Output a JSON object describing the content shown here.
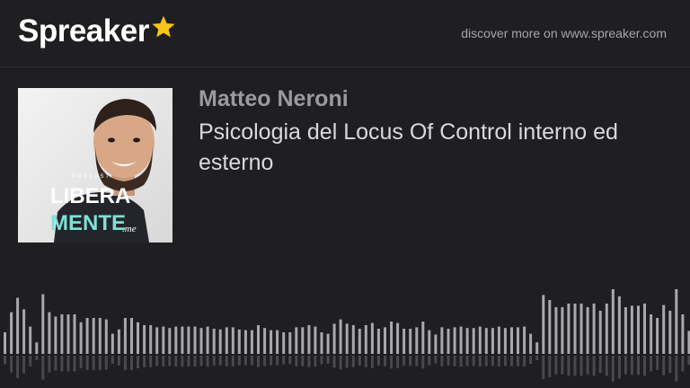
{
  "brand": {
    "name": "Spreaker"
  },
  "header": {
    "discover_text": "discover more on www.spreaker.com"
  },
  "episode": {
    "author": "Matteo Neroni",
    "title": "Psicologia del Locus Of Control interno ed esterno"
  },
  "cover": {
    "small_text": "PODCAST",
    "line1": "LIBERA",
    "line2": "MENTE",
    "suffix": ".me"
  },
  "waveform": {
    "played_color": "#6b6b6f",
    "unplayed_color": "#a9a9ad",
    "levels": [
      0.3,
      0.58,
      0.78,
      0.62,
      0.38,
      0.16,
      0.83,
      0.58,
      0.52,
      0.55,
      0.55,
      0.55,
      0.44,
      0.5,
      0.5,
      0.5,
      0.48,
      0.28,
      0.34,
      0.5,
      0.5,
      0.44,
      0.4,
      0.4,
      0.37,
      0.38,
      0.36,
      0.38,
      0.38,
      0.38,
      0.38,
      0.36,
      0.38,
      0.35,
      0.34,
      0.37,
      0.37,
      0.34,
      0.33,
      0.33,
      0.4,
      0.36,
      0.33,
      0.33,
      0.3,
      0.3,
      0.37,
      0.37,
      0.4,
      0.38,
      0.3,
      0.28,
      0.42,
      0.48,
      0.42,
      0.4,
      0.35,
      0.4,
      0.43,
      0.35,
      0.37,
      0.45,
      0.43,
      0.35,
      0.35,
      0.37,
      0.45,
      0.33,
      0.27,
      0.37,
      0.35,
      0.37,
      0.38,
      0.36,
      0.36,
      0.38,
      0.36,
      0.36,
      0.38,
      0.36,
      0.37,
      0.37,
      0.38,
      0.28,
      0.16,
      0.82,
      0.75,
      0.65,
      0.65,
      0.7,
      0.7,
      0.7,
      0.65,
      0.7,
      0.6,
      0.7,
      0.9,
      0.8,
      0.65,
      0.67,
      0.67,
      0.7,
      0.55,
      0.5,
      0.68,
      0.6,
      0.9,
      0.55,
      0.32
    ]
  }
}
